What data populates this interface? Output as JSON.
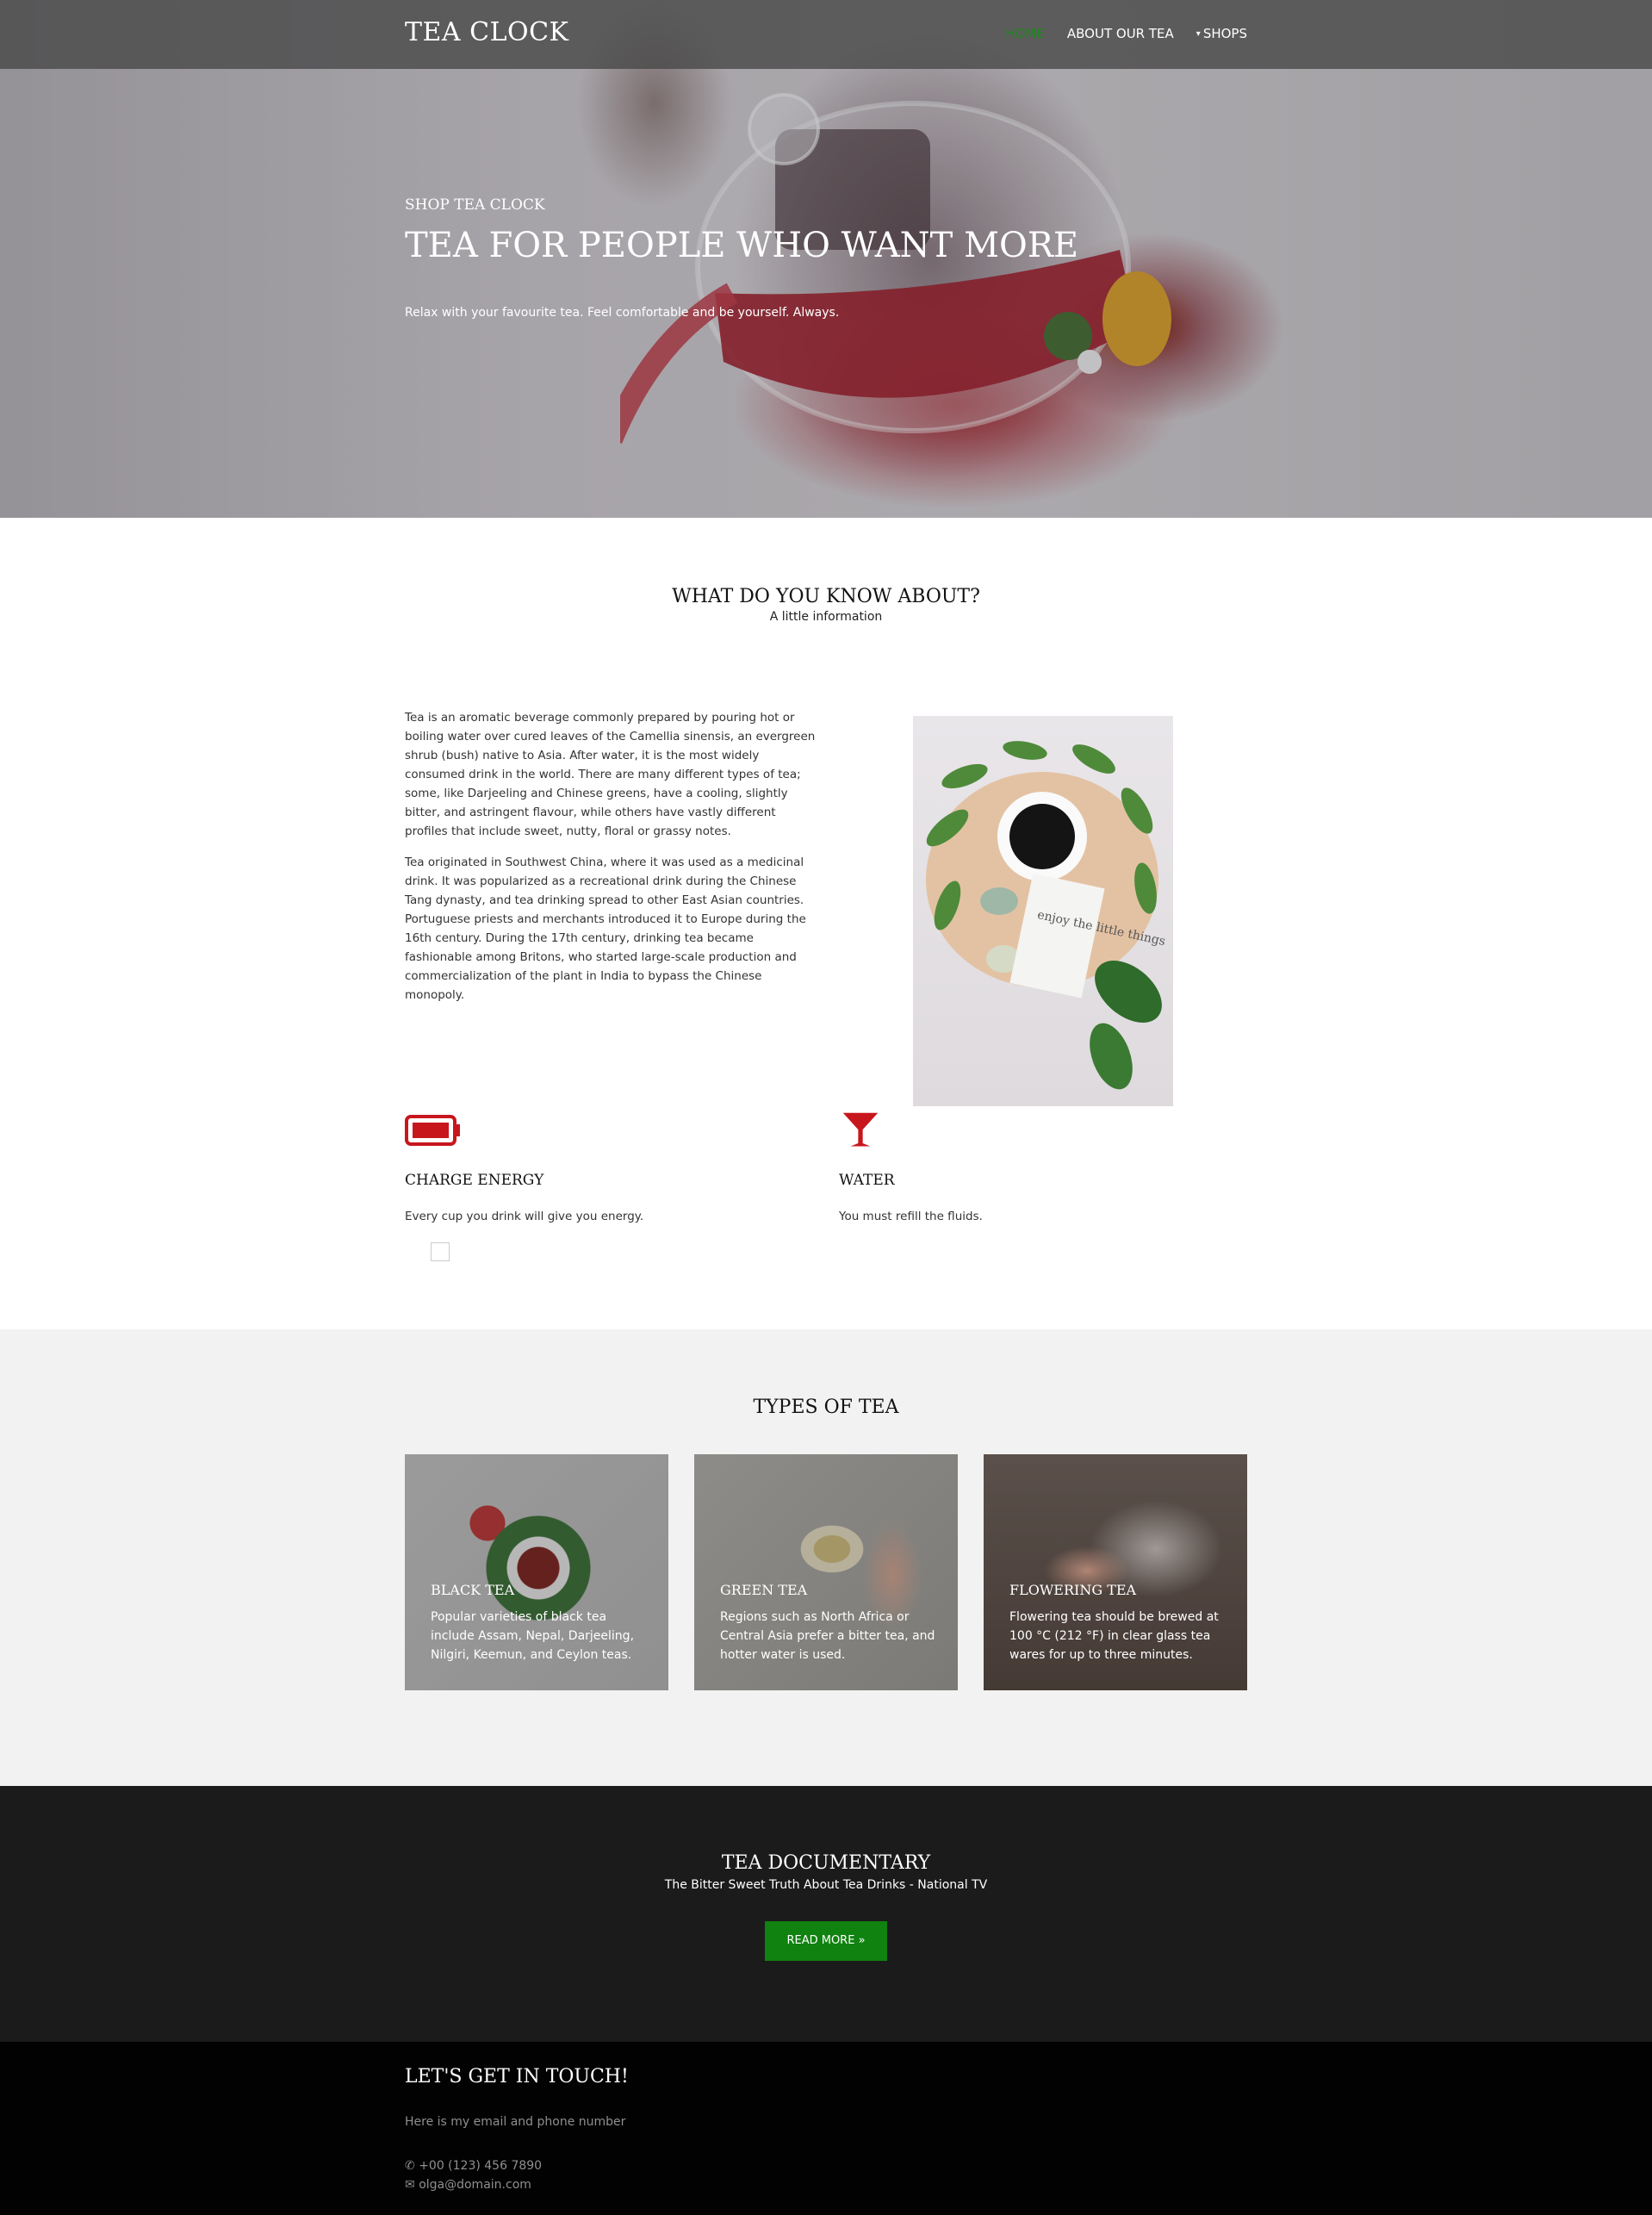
{
  "nav": {
    "logo": "TEA CLOCK",
    "items": [
      "HOME",
      "ABOUT OUR TEA",
      "SHOPS"
    ],
    "active_color": "#1e8a1e"
  },
  "hero": {
    "subtitle": "SHOP TEA CLOCK",
    "title": "TEA FOR PEOPLE WHO WANT MORE",
    "lead": "Relax with your favourite tea. Feel comfortable and be yourself. Always."
  },
  "about": {
    "title": "WHAT DO YOU KNOW ABOUT?",
    "subtitle": "A little information",
    "paragraphs": [
      "Tea is an aromatic beverage commonly prepared by pouring hot or boiling water over cured leaves of the Camellia sinensis, an evergreen shrub (bush) native to Asia. After water, it is the most widely consumed drink in the world. There are many different types of tea; some, like Darjeeling and Chinese greens, have a cooling, slightly bitter, and astringent flavour, while others have vastly different profiles that include sweet, nutty, floral or grassy notes.",
      "Tea originated in Southwest China, where it was used as a medicinal drink. It was popularized as a recreational drink during the Chinese Tang dynasty, and tea drinking spread to other East Asian countries. Portuguese priests and merchants introduced it to Europe during the 16th century. During the 17th century, drinking tea became fashionable among Britons, who started large-scale production and commercialization of the plant in India to bypass the Chinese monopoly."
    ],
    "note_text": "enjoy the little things"
  },
  "features": [
    {
      "icon": "battery-icon",
      "title": "CHARGE ENERGY",
      "text": "Every cup you drink will give you energy."
    },
    {
      "icon": "glass-icon",
      "title": "WATER",
      "text": "You must refill the fluids."
    }
  ],
  "accent_red": "#c8161d",
  "types": {
    "title": "TYPES OF TEA",
    "cards": [
      {
        "title": "BLACK TEA",
        "text": "Popular varieties of black tea include Assam, Nepal, Darjeeling, Nilgiri, Keemun, and Ceylon teas."
      },
      {
        "title": "GREEN TEA",
        "text": "Regions such as North Africa or Central Asia prefer a bitter tea, and hotter water is used."
      },
      {
        "title": "FLOWERING TEA",
        "text": "Flowering tea should be brewed at 100 °C (212 °F) in clear glass tea wares for up to three minutes."
      }
    ]
  },
  "documentary": {
    "title": "TEA DOCUMENTARY",
    "subtitle": "The Bitter Sweet Truth About Tea Drinks - National TV",
    "button": "READ MORE »",
    "button_color": "#0f820f"
  },
  "footer": {
    "title": "LET'S GET IN TOUCH!",
    "subtitle": "Here is my email and phone number",
    "phone": "+00 (123) 456 7890",
    "email": "olga@domain.com"
  }
}
